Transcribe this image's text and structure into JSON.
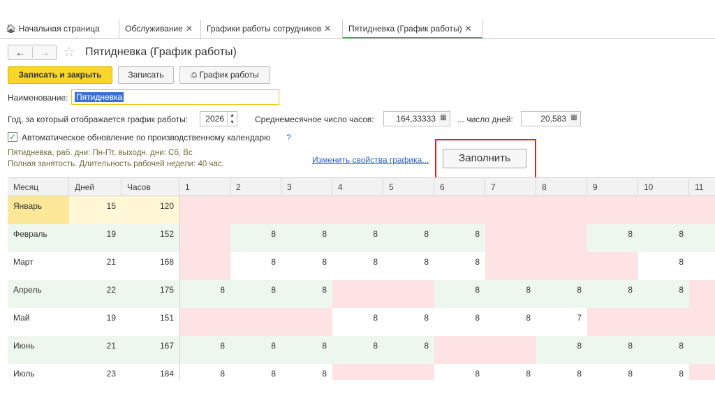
{
  "tabs": [
    {
      "label": "Начальная страница",
      "icon": "home-icon",
      "closable": false,
      "active": false
    },
    {
      "label": "Обслуживание",
      "closable": true,
      "active": false
    },
    {
      "label": "Графики работы сотрудников",
      "closable": true,
      "active": false
    },
    {
      "label": "Пятидневка (График работы)",
      "closable": true,
      "active": true
    }
  ],
  "header": {
    "back_glyph": "←",
    "forward_glyph": "→",
    "favorite_glyph": "☆",
    "title": "Пятидневка (График работы)"
  },
  "toolbar": {
    "save_close": "Записать и закрыть",
    "save": "Записать",
    "schedule": "График работы",
    "schedule_icon": "printer-icon"
  },
  "form": {
    "name_label": "Наименование:",
    "name_value": "Пятидневка",
    "year_label": "Год, за который отображается график работы:",
    "year_value": "2026",
    "avg_hours_label": "Среднемесячное число часов:",
    "avg_hours_value": "164,33333",
    "avg_days_label": "... число дней:",
    "avg_days_value": "20,583",
    "auto_update_label": "Автоматическое обновление по производственному календарю",
    "auto_update_checked": true,
    "help_glyph": "?",
    "note_line1": "Пятидневка, раб. дни: Пн-Пт, выходн. дни: Сб, Вс",
    "note_line2": "Полная занятость. Длительность рабочей недели: 40 час.",
    "change_link": "Изменить свойства графика...",
    "fill_button": "Заполнить"
  },
  "colors": {
    "weekend": "#fde3e3",
    "workday_alt": "#eef7ee",
    "workday": "#ffffff",
    "selected_row": "#fde89a",
    "selected_row_light": "#fff7d6",
    "accent": "#f9d629",
    "highlight_frame": "#e02020"
  },
  "grid": {
    "headers": [
      "Месяц",
      "Дней",
      "Часов",
      "1",
      "2",
      "3",
      "4",
      "5",
      "6",
      "7",
      "8",
      "9",
      "10",
      "11"
    ],
    "rows": [
      {
        "month": "Январь",
        "days": "15",
        "hours": "120",
        "cells": [
          "",
          "",
          "",
          "",
          "",
          "",
          "",
          "",
          "",
          "",
          ""
        ],
        "weekend": [
          1,
          1,
          1,
          1,
          1,
          1,
          1,
          1,
          1,
          1,
          1
        ]
      },
      {
        "month": "Февраль",
        "days": "19",
        "hours": "152",
        "cells": [
          "",
          "8",
          "8",
          "8",
          "8",
          "8",
          "",
          "",
          "8",
          "8",
          ""
        ],
        "weekend": [
          1,
          0,
          0,
          0,
          0,
          0,
          1,
          1,
          0,
          0,
          0
        ]
      },
      {
        "month": "Март",
        "days": "21",
        "hours": "168",
        "cells": [
          "",
          "8",
          "8",
          "8",
          "8",
          "8",
          "",
          "",
          "",
          "8",
          ""
        ],
        "weekend": [
          1,
          0,
          0,
          0,
          0,
          0,
          1,
          1,
          1,
          0,
          0
        ]
      },
      {
        "month": "Апрель",
        "days": "22",
        "hours": "175",
        "cells": [
          "8",
          "8",
          "8",
          "",
          "",
          "8",
          "8",
          "8",
          "8",
          "8",
          ""
        ],
        "weekend": [
          0,
          0,
          0,
          1,
          1,
          0,
          0,
          0,
          0,
          0,
          1
        ]
      },
      {
        "month": "Май",
        "days": "19",
        "hours": "151",
        "cells": [
          "",
          "",
          "",
          "8",
          "8",
          "8",
          "8",
          "7",
          "",
          "",
          ""
        ],
        "weekend": [
          1,
          1,
          1,
          0,
          0,
          0,
          0,
          0,
          1,
          1,
          1
        ]
      },
      {
        "month": "Июнь",
        "days": "21",
        "hours": "167",
        "cells": [
          "8",
          "8",
          "8",
          "8",
          "8",
          "",
          "",
          "8",
          "8",
          "8",
          ""
        ],
        "weekend": [
          0,
          0,
          0,
          0,
          0,
          1,
          1,
          0,
          0,
          0,
          0
        ]
      },
      {
        "month": "Июль",
        "days": "23",
        "hours": "184",
        "cells": [
          "8",
          "8",
          "8",
          "",
          "",
          "8",
          "8",
          "8",
          "8",
          "8",
          ""
        ],
        "weekend": [
          0,
          0,
          0,
          1,
          1,
          0,
          0,
          0,
          0,
          0,
          1
        ]
      }
    ]
  }
}
